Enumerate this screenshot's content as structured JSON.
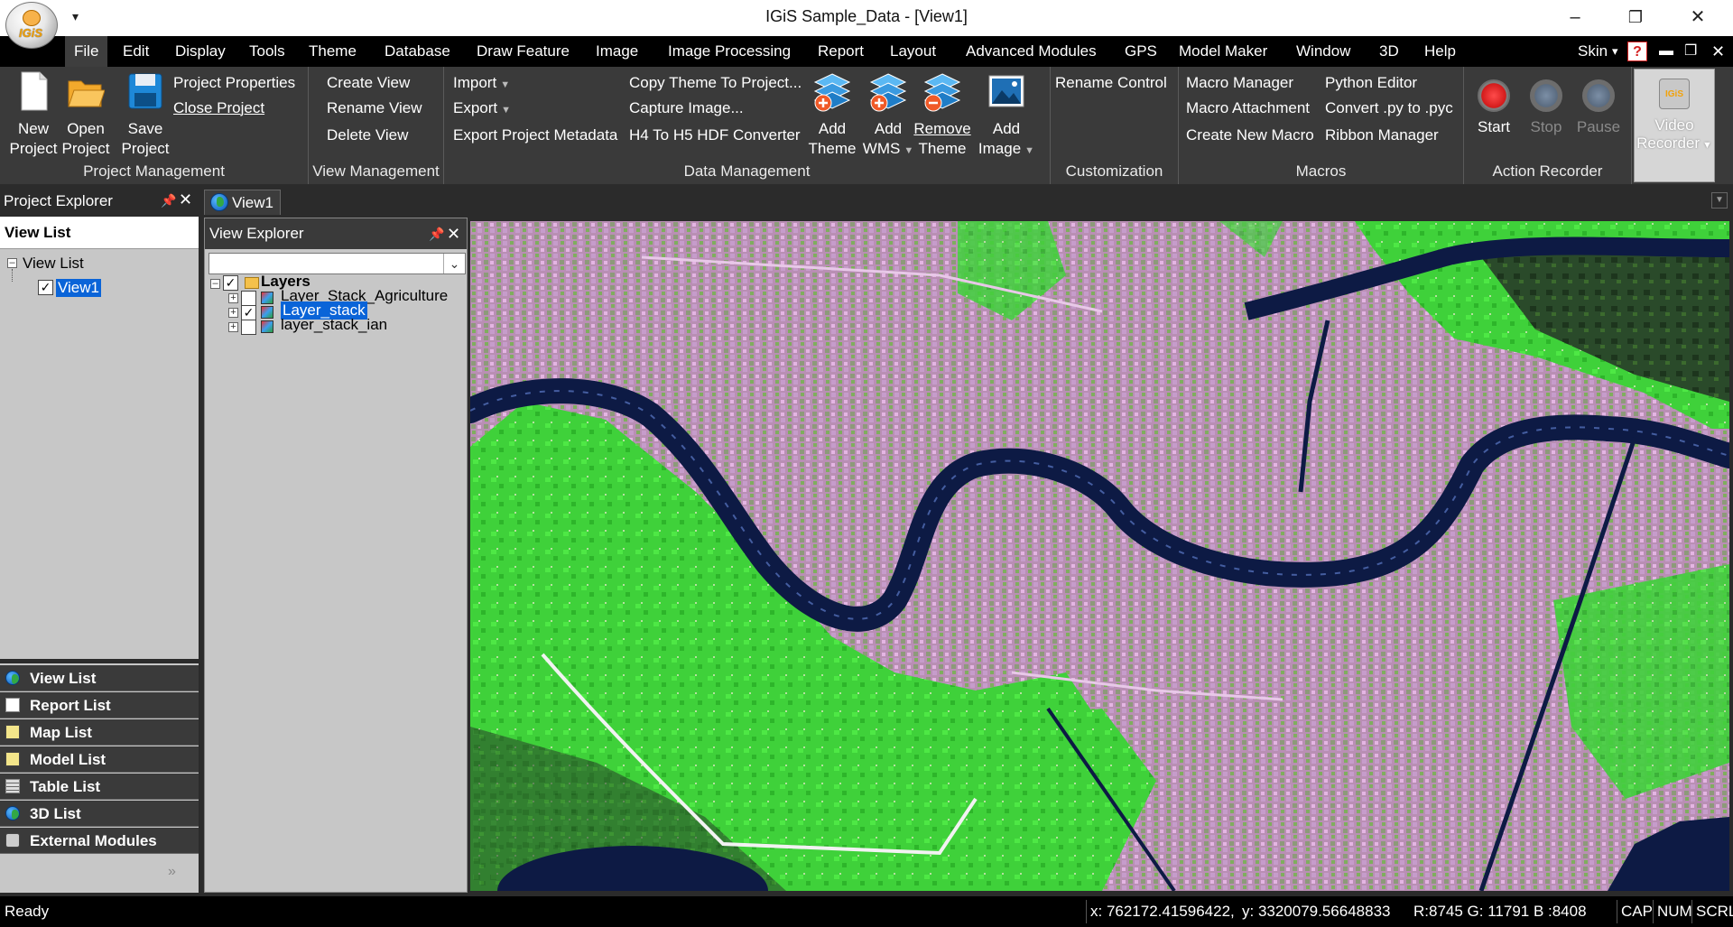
{
  "window": {
    "title": "IGiS Sample_Data - [View1]",
    "logo_text": "IGiS",
    "qat_arrow": "▾",
    "minimize": "–",
    "restore": "❐",
    "close": "✕"
  },
  "menu": {
    "items": [
      "File",
      "Edit",
      "Display",
      "Tools",
      "Theme",
      "Database",
      "Draw Feature",
      "Image",
      "Image Processing",
      "Report",
      "Layout",
      "Advanced Modules",
      "GPS",
      "Model Maker",
      "Window",
      "3D",
      "Help"
    ],
    "skin_label": "Skin",
    "skin_arrow": "▾",
    "help_q": "?"
  },
  "ribbon": {
    "project_management": {
      "caption": "Project Management",
      "new_label_1": "New",
      "new_label_2": "Project",
      "open_label_1": "Open",
      "open_label_2": "Project",
      "save_label_1": "Save",
      "save_label_2": "Project",
      "properties": "Project Properties",
      "close": "Close Project"
    },
    "view_management": {
      "caption": "View Management",
      "create": "Create View",
      "rename": "Rename View",
      "delete": "Delete View"
    },
    "data_management": {
      "caption": "Data Management",
      "import": "Import",
      "export": "Export",
      "export_metadata": "Export Project Metadata",
      "copy_theme": "Copy Theme To Project...",
      "capture_image": "Capture Image...",
      "hdf_converter": "H4 To H5 HDF Converter",
      "add_theme_1": "Add",
      "add_theme_2": "Theme",
      "add_wms_1": "Add",
      "add_wms_2": "WMS",
      "remove_theme_1": "Remove",
      "remove_theme_2": "Theme",
      "add_image_1": "Add",
      "add_image_2": "Image"
    },
    "customization": {
      "caption": "Customization",
      "rename_control": "Rename Control"
    },
    "macros": {
      "caption": "Macros",
      "macro_manager": "Macro Manager",
      "macro_attachment": "Macro Attachment",
      "create_macro": "Create New Macro",
      "python_editor": "Python Editor",
      "convert_py": "Convert .py to .pyc",
      "ribbon_manager": "Ribbon Manager"
    },
    "action_recorder": {
      "caption": "Action Recorder",
      "start": "Start",
      "stop": "Stop",
      "pause": "Pause"
    },
    "video_recorder": {
      "label_1": "Video",
      "label_2": "Recorder",
      "logo": "IGiS"
    }
  },
  "project_explorer": {
    "title": "Project Explorer",
    "strip_title": "View List",
    "tree_root": "View List",
    "tree_child": "View1",
    "tree_child_checked": true,
    "lists": [
      "View List",
      "Report List",
      "Map List",
      "Model List",
      "Table List",
      "3D List",
      "External Modules"
    ],
    "more": "»"
  },
  "view_tab": {
    "label": "View1"
  },
  "view_explorer": {
    "title": "View Explorer",
    "combo_value": "",
    "combo_arrow": "⌵",
    "group_label": "Layers",
    "layers": [
      {
        "label": "Layer_Stack_Agriculture",
        "checked": false,
        "selected": false
      },
      {
        "label": "Layer_stack",
        "checked": true,
        "selected": true
      },
      {
        "label": "layer_stack_ian",
        "checked": false,
        "selected": false
      }
    ]
  },
  "status": {
    "ready": "Ready",
    "x": "x: 762172.41596422,",
    "y": "y: 3320079.56648833",
    "rgb": "R:8745 G: 11791 B :8408",
    "cap": "CAP",
    "num": "NUM",
    "scrl": "SCRL"
  },
  "icons": {
    "pin": "pin-icon",
    "close": "close-icon",
    "globe": "globe-icon",
    "layer": "layer-raster-icon"
  },
  "colors": {
    "selection": "#0a64d8",
    "ribbon_bg": "#3a3a3a",
    "menu_bg": "#000000",
    "river": "#0d1a44",
    "vegetation": "#39d93a",
    "urban": "#d59ad8"
  }
}
